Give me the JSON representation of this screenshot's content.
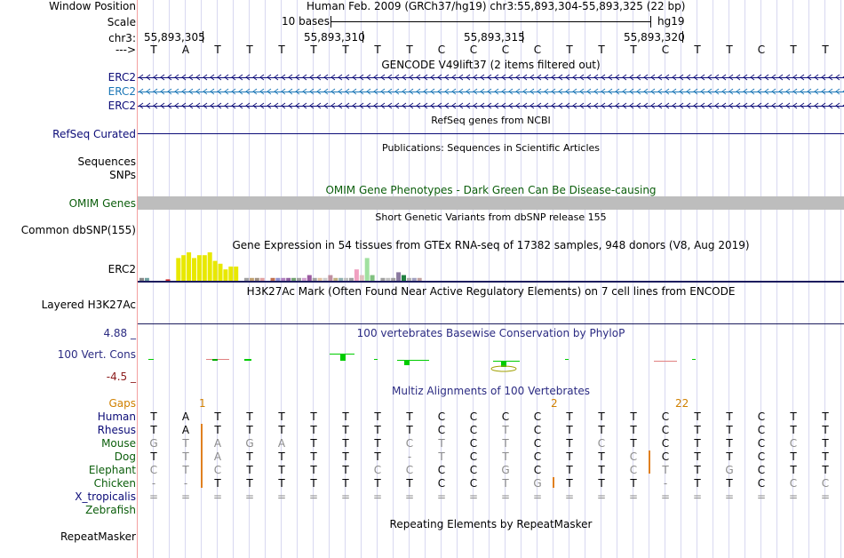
{
  "header": {
    "window_position_label": "Window Position",
    "window_position_value": "Human Feb. 2009 (GRCh37/hg19)   chr3:55,893,304-55,893,325 (22 bp)",
    "scale_label": "Scale",
    "scale_value": "10 bases",
    "scale_db": "hg19",
    "chr_label": "chr3:",
    "positions": [
      "55,893,305",
      "55,893,310",
      "55,893,315",
      "55,893,320"
    ],
    "arrow_label": "--->"
  },
  "sequence": [
    "T",
    "A",
    "T",
    "T",
    "T",
    "T",
    "T",
    "T",
    "T",
    "C",
    "C",
    "C",
    "C",
    "T",
    "T",
    "T",
    "C",
    "T",
    "T",
    "C",
    "T",
    "T"
  ],
  "tracks": {
    "gencode": {
      "title": "GENCODE V49lift37 (2 items filtered out)",
      "genes": [
        {
          "label": "ERC2",
          "color": "#0c0c78"
        },
        {
          "label": "ERC2",
          "color": "#1a76b6"
        },
        {
          "label": "ERC2",
          "color": "#0c0c78"
        }
      ]
    },
    "refseq": {
      "title": "RefSeq genes from NCBI",
      "label": "RefSeq Curated",
      "color": "#0c0c78"
    },
    "publications": {
      "title": "Publications: Sequences in Scientific Articles",
      "label1": "Sequences",
      "label2": "SNPs"
    },
    "omim": {
      "title": "OMIM Gene Phenotypes - Dark Green Can Be Disease-causing",
      "label": "OMIM Genes",
      "color": "#0b5e0b",
      "bar_color": "#bdbdbd"
    },
    "dbsnp": {
      "title": "Short Genetic Variants from dbSNP release 155",
      "label": "Common dbSNP(155)"
    },
    "gtex": {
      "title": "Gene Expression in 54 tissues from GTEx RNA-seq of 17382 samples, 948 donors (V8, Aug 2019)",
      "label": "ERC2"
    },
    "h3k27ac": {
      "title": "H3K27Ac Mark (Often Found Near Active Regulatory Elements) on 7 cell lines from ENCODE",
      "label": "Layered H3K27Ac"
    },
    "phylop": {
      "title": "100 vertebrates Basewise Conservation by PhyloP",
      "label": "100 Vert. Cons",
      "max": "4.88 _",
      "min": "-4.5 _",
      "color": "#2b2b82",
      "min_color": "#8b1a1a"
    },
    "multiz": {
      "title": "Multiz Alignments of 100 Vertebrates",
      "gaps_label": "Gaps",
      "gap_marks": [
        "1",
        "2",
        "22"
      ],
      "species": [
        {
          "name": "Human",
          "color": "#0c0c78",
          "bases": [
            "T",
            "A",
            "T",
            "T",
            "T",
            "T",
            "T",
            "T",
            "T",
            "C",
            "C",
            "C",
            "C",
            "T",
            "T",
            "T",
            "C",
            "T",
            "T",
            "C",
            "T",
            "T"
          ]
        },
        {
          "name": "Rhesus",
          "color": "#0c0c78",
          "bases": [
            "T",
            "A",
            "T",
            "T",
            "T",
            "T",
            "T",
            "T",
            "T",
            "C",
            "C",
            "T",
            "C",
            "T",
            "T",
            "T",
            "C",
            "T",
            "T",
            "C",
            "T",
            "T"
          ]
        },
        {
          "name": "Mouse",
          "color": "#0b5e0b",
          "bases": [
            "G",
            "T",
            "A",
            "G",
            "A",
            "T",
            "T",
            "T",
            "C",
            "T",
            "C",
            "T",
            "C",
            "T",
            "C",
            "T",
            "C",
            "T",
            "T",
            "C",
            "C",
            "T"
          ]
        },
        {
          "name": "Dog",
          "color": "#0b5e0b",
          "bases": [
            "T",
            "T",
            "A",
            "T",
            "T",
            "T",
            "T",
            "T",
            "-",
            "T",
            "C",
            "T",
            "C",
            "T",
            "T",
            "C",
            "C",
            "T",
            "T",
            "C",
            "T",
            "T"
          ]
        },
        {
          "name": "Elephant",
          "color": "#0b5e0b",
          "bases": [
            "C",
            "T",
            "C",
            "T",
            "T",
            "T",
            "T",
            "C",
            "C",
            "C",
            "C",
            "G",
            "C",
            "T",
            "T",
            "C",
            "T",
            "T",
            "G",
            "C",
            "T",
            "T"
          ]
        },
        {
          "name": "Chicken",
          "color": "#0b5e0b",
          "bases": [
            "-",
            "-",
            "T",
            "T",
            "T",
            "T",
            "T",
            "T",
            "T",
            "C",
            "C",
            "T",
            "G",
            "T",
            "T",
            "T",
            "-",
            "T",
            "T",
            "C",
            "C",
            "C"
          ]
        },
        {
          "name": "X_tropicalis",
          "color": "#0c0c78",
          "bases": [
            "=",
            "=",
            "=",
            "=",
            "=",
            "=",
            "=",
            "=",
            "=",
            "=",
            "=",
            "=",
            "=",
            "=",
            "=",
            "=",
            "=",
            "=",
            "=",
            "=",
            "=",
            "="
          ]
        },
        {
          "name": "Zebrafish",
          "color": "#0b5e0b",
          "bases": []
        }
      ]
    },
    "repeatmasker": {
      "title": "Repeating Elements by RepeatMasker",
      "label": "RepeatMasker"
    }
  },
  "chart_data": {
    "type": "bar",
    "title": "Gene Expression in 54 tissues from GTEx RNA-seq of 17382 samples, 948 donors (V8, Aug 2019)",
    "series": [
      {
        "values": [
          1,
          1,
          0,
          0,
          0,
          0.5,
          0,
          8,
          9,
          10,
          8,
          9,
          9,
          10,
          7,
          6,
          4,
          5,
          5,
          0,
          1,
          1,
          1,
          1,
          0,
          1,
          1,
          1,
          1,
          1,
          1,
          1,
          2,
          1,
          1,
          1,
          2,
          1,
          1,
          1,
          1,
          4,
          2,
          8,
          2,
          0,
          1,
          1,
          1,
          3,
          2,
          1,
          1,
          1
        ],
        "colors": [
          "#888888",
          "#6fa0a0",
          "#ffffff",
          "#ffffff",
          "#ffffff",
          "#cc2222",
          "#ffffff",
          "#e8e800",
          "#e8e800",
          "#e8e800",
          "#e8e800",
          "#e8e800",
          "#e8e800",
          "#e8e800",
          "#e8e800",
          "#e8e800",
          "#e8e800",
          "#e8e800",
          "#e8e800",
          "#ffffff",
          "#a0a0a0",
          "#c0a070",
          "#a09080",
          "#e0a0a0",
          "#ffffff",
          "#c07050",
          "#9090d0",
          "#b080c0",
          "#9060a0",
          "#70a070",
          "#a0a0a0",
          "#d0a0d0",
          "#9a5aa0",
          "#a0a0a0",
          "#e0c0a0",
          "#cccccc",
          "#c090a0",
          "#c0b080",
          "#90b0b0",
          "#c0c0c0",
          "#a0a0a0",
          "#f0a0c0",
          "#e0c0c0",
          "#a0e0a0",
          "#80c080",
          "#ffffff",
          "#a0a0a0",
          "#c0c0c0",
          "#a0a0a0",
          "#8a7aa0",
          "#208040",
          "#b0b0b0",
          "#a0a0c0",
          "#c0a0a0"
        ]
      }
    ]
  }
}
